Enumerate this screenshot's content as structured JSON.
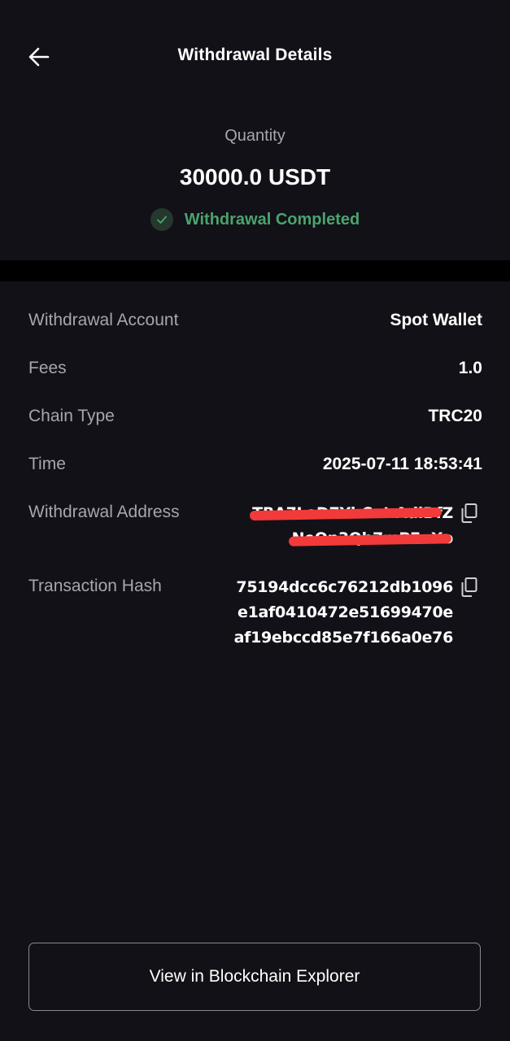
{
  "header": {
    "title": "Withdrawal Details"
  },
  "summary": {
    "quantity_label": "Quantity",
    "quantity_value": "30000.0 USDT",
    "status_text": "Withdrawal Completed",
    "status_color": "#4ba36d"
  },
  "details": {
    "withdrawal_account_label": "Withdrawal Account",
    "withdrawal_account_value": "Spot Wallet",
    "fees_label": "Fees",
    "fees_value": "1.0",
    "chain_type_label": "Chain Type",
    "chain_type_value": "TRC20",
    "time_label": "Time",
    "time_value": "2025-07-11 18:53:41",
    "withdrawal_address_label": "Withdrawal Address",
    "withdrawal_address_value": "TRA7LoD7YbCnt AdiDfZ NeOn3Qb7mPEuXo",
    "transaction_hash_label": "Transaction Hash",
    "transaction_hash_value": "75194dcc6c76212db1096e1af0410472e51699470eaf19ebccd85e7f166a0e76"
  },
  "footer": {
    "explorer_button_label": "View in Blockchain Explorer"
  },
  "icons": {
    "back": "arrow-left-icon",
    "status": "check-circle-icon",
    "copy": "copy-icon"
  },
  "colors": {
    "background": "#121117",
    "divider": "#000000",
    "label_text": "#a7a6ad",
    "redaction": "#f23a3a"
  }
}
